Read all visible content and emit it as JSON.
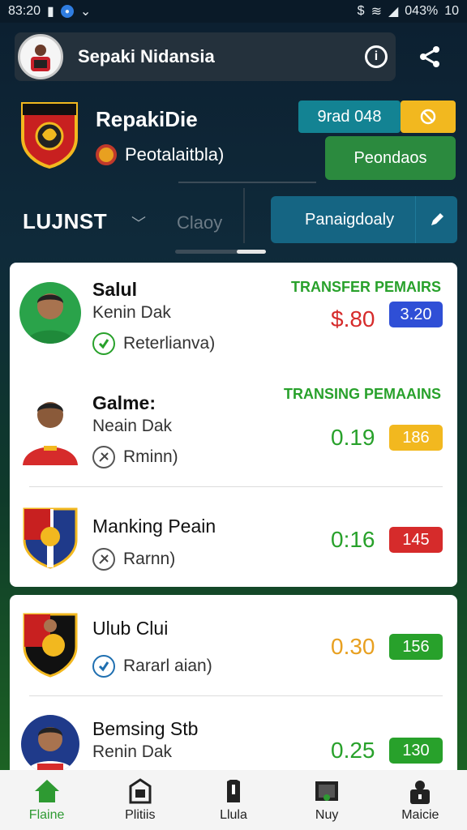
{
  "status_bar": {
    "time": "83:20",
    "right_text": "043%",
    "extra": "10"
  },
  "appbar": {
    "title": "Sepaki Nidansia"
  },
  "club": {
    "name": "RepakiDie",
    "subtitle": "Peotalaitbla)"
  },
  "buttons": {
    "grad": "9rad 048",
    "pend": "Peondaos",
    "panel": "Panaigdoaly"
  },
  "tabs": {
    "active": "LUJNST",
    "other": "Claoy"
  },
  "rows": [
    {
      "name": "Salul",
      "sub": "Kenin Dak",
      "status": "Reterlianva)",
      "header": "TRANSFER PEMAIRS",
      "price": "$.80",
      "badge": "3.20"
    },
    {
      "name": "Galme:",
      "sub": "Neain Dak",
      "status": "Rminn)",
      "header": "TRANSING PEMAAINS",
      "price": "0.19",
      "badge": "186"
    },
    {
      "name": "Manking Peain",
      "sub": "",
      "status": "Rarnn)",
      "header": "",
      "price": "0:16",
      "badge": "145"
    },
    {
      "name": "Ulub Clui",
      "sub": "",
      "status": "Rararl aian)",
      "header": "",
      "price": "0.30",
      "badge": "156"
    },
    {
      "name": "Bemsing Stb",
      "sub": "Renin Dak",
      "status": "",
      "header": "",
      "price": "0.25",
      "badge": "130"
    }
  ],
  "colors": {
    "green": "#28a12b",
    "red": "#d62b2b",
    "yellow": "#f2b81f",
    "blue": "#2f4fd6",
    "teal": "#138393"
  },
  "bottom_nav": [
    {
      "label": "Flaine",
      "icon": "home-icon"
    },
    {
      "label": "Plitiis",
      "icon": "building-icon"
    },
    {
      "label": "Llula",
      "icon": "shirt-icon"
    },
    {
      "label": "Nuy",
      "icon": "goal-icon"
    },
    {
      "label": "Maicie",
      "icon": "lock-icon"
    }
  ]
}
